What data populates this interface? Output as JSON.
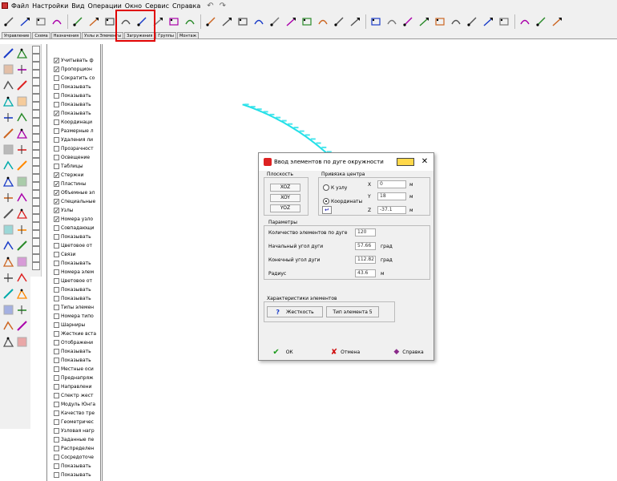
{
  "menu": {
    "items": [
      "Файл",
      "Настройки",
      "Вид",
      "Операции",
      "Окно",
      "Сервис",
      "Справка"
    ]
  },
  "tabs": [
    "Управление",
    "Схема",
    "Назначения",
    "Узлы и Элементы",
    "Загружения",
    "Группы",
    "Монтаж"
  ],
  "tree": {
    "rows": [
      {
        "label": "Учитывать ф",
        "check": true
      },
      {
        "label": "Пропорцион",
        "check": true
      },
      {
        "label": "Сократить со",
        "check": false
      },
      {
        "label": "Показывать",
        "check": false
      },
      {
        "label": "Показывать",
        "check": false
      },
      {
        "label": "Показывать",
        "check": false
      },
      {
        "label": "Показывать",
        "check": true
      },
      {
        "label": "Координаци",
        "check": false
      },
      {
        "label": "Размерные л",
        "check": false
      },
      {
        "label": "Удаления ли",
        "check": false
      },
      {
        "label": "Прозрачност",
        "check": false
      },
      {
        "label": "Освещение",
        "check": false
      },
      {
        "label": "Таблицы",
        "check": false
      },
      {
        "label": "Стержни",
        "check": true
      },
      {
        "label": "Пластины",
        "check": true
      },
      {
        "label": "Объемные эл",
        "check": true
      },
      {
        "label": "Специальные",
        "check": true
      },
      {
        "label": "Узлы",
        "check": true
      },
      {
        "label": "Номера узло",
        "check": true
      },
      {
        "label": "Совпадающи",
        "check": false
      },
      {
        "label": "Показывать",
        "check": false
      },
      {
        "label": "Цветовое от",
        "check": false
      },
      {
        "label": "Связи",
        "check": false
      },
      {
        "label": "Показывать",
        "check": false
      },
      {
        "label": "Номера элем",
        "check": false
      },
      {
        "label": "Цветовое от",
        "check": false
      },
      {
        "label": "Показывать",
        "check": false
      },
      {
        "label": "Показывать",
        "check": false
      },
      {
        "label": "Типы элемен",
        "check": false
      },
      {
        "label": "Номера типо",
        "check": false
      },
      {
        "label": "Шарниры",
        "check": false
      },
      {
        "label": "Жесткие вста",
        "check": false
      },
      {
        "label": "Отображени",
        "check": false
      },
      {
        "label": "Показывать",
        "check": false
      },
      {
        "label": "Показывать",
        "check": false
      },
      {
        "label": "Местные оси",
        "check": false
      },
      {
        "label": "Преднапряж",
        "check": false
      },
      {
        "label": "Направлени",
        "check": false
      },
      {
        "label": "Спектр жест",
        "check": false
      },
      {
        "label": "Модуль Юнга",
        "check": false
      },
      {
        "label": "Качество тре",
        "check": false
      },
      {
        "label": "Геометричес",
        "check": false
      },
      {
        "label": "Узловая нагр",
        "check": false
      },
      {
        "label": "Заданные пе",
        "check": false
      },
      {
        "label": "Распределен",
        "check": false
      },
      {
        "label": "Сосредоточе",
        "check": false
      },
      {
        "label": "Показывать",
        "check": false
      },
      {
        "label": "Показывать",
        "check": false
      },
      {
        "label": "Кол-степени",
        "check": false
      }
    ]
  },
  "dialog": {
    "title": "Ввод элементов по дуге окружности",
    "plane_group": "Плоскость",
    "plane_options": [
      "XOZ",
      "XOY",
      "YOZ"
    ],
    "binding_group": "Привязка центра",
    "radio_node": "К узлу",
    "radio_coords": "Координаты",
    "x_label": "X",
    "x_value": "0",
    "y_label": "Y",
    "y_value": "18",
    "z_label": "Z",
    "z_value": "-37.1",
    "unit_m": "м",
    "params_group": "Параметры",
    "count_label": "Количество элементов по дуге",
    "count_value": "120",
    "start_angle_label": "Начальный угол дуги",
    "start_angle_value": "57.66",
    "end_angle_label": "Конечный угол дуги",
    "end_angle_value": "112.82",
    "unit_deg": "град",
    "radius_label": "Радиус",
    "radius_value": "43.6",
    "char_group": "Характеристики элементов",
    "stiffness_button": "Жесткость",
    "elem_type_button": "Тип элемента  5",
    "ok_button": "ОК",
    "cancel_button": "Отмена",
    "help_button": "Справка"
  },
  "colors": {
    "arc": "#22e0e8",
    "highlight": "#e00000"
  }
}
